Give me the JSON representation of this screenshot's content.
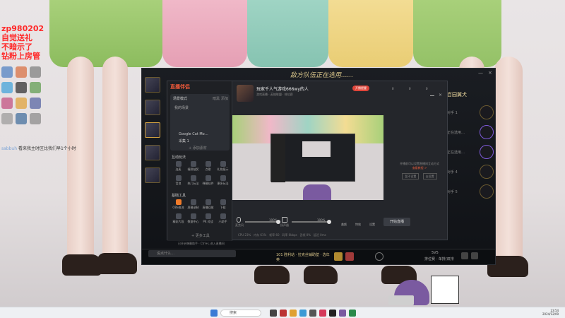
{
  "overlay": {
    "lines": [
      "zp980202",
      "自觉送礼",
      "不暗示了",
      "钻粉上房管"
    ],
    "chat_user": "sabbuh",
    "chat_msg": "看来我主时区比我们早1个小时"
  },
  "game_client": {
    "title": "敌方队伍正在选用......",
    "window_controls": [
      "—",
      "×"
    ],
    "right_panel": {
      "head": "百园翼犬",
      "rows": [
        "对手 1",
        "正在选用…",
        "正在选用…",
        "对手 4",
        "对手 5"
      ]
    },
    "status": {
      "queue": "101 胜利站 · 拉克丝辅助壁 · 选年英",
      "mode": "排位赛 · 单排/双排",
      "score": "5V5"
    }
  },
  "streaming_app": {
    "logo": "直播伴侣",
    "sidebar": {
      "section1_title": "场景模式",
      "section1_links": [
        "暗黑",
        "添加"
      ],
      "scene_items": [
        "我的场景",
        "Google Cat Mo…",
        "采集 1"
      ],
      "add_scene": "+ 添加素材",
      "section2_title": "互动玩法",
      "tools_row1": [
        "连麦",
        "福袋抽奖",
        "点歌",
        "礼物展示"
      ],
      "tools_row2": [
        "音浪",
        "热门玩法",
        "弹幕挂件",
        "更多玩法"
      ],
      "section3_title": "基础工具",
      "tools_row3": [
        "OBS推流",
        "屏幕录制",
        "直播回放",
        "下载"
      ],
      "tools_row4": [
        "精彩片段",
        "数据中心",
        "PK 对战",
        "小助手"
      ],
      "more_tools": "+ 更多工具"
    },
    "room": {
      "title": "玩家千人气游戏666wy的人",
      "subtitle": "游戏直播 · 英雄联盟 · 排位赛",
      "badge": "开播提醒",
      "stats_top": [
        "0",
        "0",
        "0"
      ]
    },
    "side_message": {
      "text": "开播前可以设置直播间互动方式",
      "link": "查看教程 >",
      "buttons": [
        "暂不设置",
        "去设置"
      ]
    },
    "controls": {
      "mic_label": "麦克风",
      "mic_value": "100%",
      "speaker_label": "扬声器",
      "speaker_value": "100%",
      "beauty": "美颜",
      "effect": "特效",
      "settings": "设置",
      "start": "开始直播"
    },
    "stats": [
      "CPU 23%",
      "内存 61%",
      "帧率 60",
      "码率 0kbps",
      "丢帧 0%",
      "延迟 0ms"
    ],
    "chat_placeholder": "说点什么…",
    "chat_hint": "已开启弹幕助手 · Ctrl+L 进入直播间"
  },
  "taskbar": {
    "search": "搜索",
    "time": "23:54",
    "date": "2024/12/09"
  },
  "colors": {
    "accent": "#f05a3a",
    "gold": "#d9c58a",
    "purple": "#7e5ad8"
  }
}
